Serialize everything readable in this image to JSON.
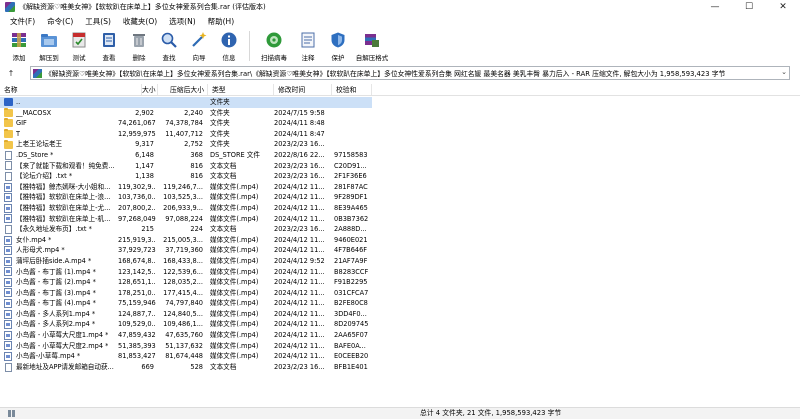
{
  "window": {
    "title": "《解缺资源♡唯美女神》【软软趴在床单上】多位女神爱系列合集.rar (评估版本)",
    "minimize": "—",
    "maximize": "☐",
    "close": "✕"
  },
  "menu": [
    {
      "label": "文件(F)"
    },
    {
      "label": "命令(C)"
    },
    {
      "label": "工具(S)"
    },
    {
      "label": "收藏夹(O)"
    },
    {
      "label": "选项(N)"
    },
    {
      "label": "帮助(H)"
    }
  ],
  "toolbar": [
    {
      "label": "添加",
      "icon": "add-archive-icon",
      "color": "#7b2f8f"
    },
    {
      "label": "解压到",
      "icon": "extract-folder-icon",
      "color": "#3b78c4"
    },
    {
      "label": "测试",
      "icon": "test-icon",
      "color": "#c62e2e"
    },
    {
      "label": "查看",
      "icon": "view-book-icon",
      "color": "#2f5fa8"
    },
    {
      "label": "删除",
      "icon": "delete-trash-icon",
      "color": "#7a7a7a"
    },
    {
      "label": "查找",
      "icon": "find-magnifier-icon",
      "color": "#2a5ba8"
    },
    {
      "label": "向导",
      "icon": "wizard-wand-icon",
      "color": "#2d6bb5"
    },
    {
      "label": "信息",
      "icon": "info-icon",
      "color": "#2f64b0"
    },
    {
      "label": "扫描病毒",
      "icon": "virus-scan-icon",
      "color": "#2f9a3a"
    },
    {
      "label": "注释",
      "icon": "comment-icon",
      "color": "#4c6fa8"
    },
    {
      "label": "保护",
      "icon": "protect-shield-icon",
      "color": "#2e6fc0"
    },
    {
      "label": "自解压格式",
      "icon": "sfx-icon",
      "color": "#4a7a3a"
    }
  ],
  "address": {
    "up_arrow": "↑",
    "text": "《解缺资源♡唯美女神》【软软趴在床单上】多位女神爱系列合集.rar\\《解缺资源♡唯美女神》【软软趴在床单上】多位女神性爱系列合集 网红名媛 最美名器 美乳丰臀 暴力后入 - RAR 压缩文件, 解包大小为 1,958,593,423 字节",
    "dropdown": "⌄"
  },
  "columns": [
    {
      "label": "名称"
    },
    {
      "label": "大小"
    },
    {
      "label": "压缩后大小"
    },
    {
      "label": "类型"
    },
    {
      "label": "修改时间"
    },
    {
      "label": "校验和"
    }
  ],
  "files": [
    {
      "kind": "up",
      "name": "..",
      "size": "",
      "packed": "",
      "type": "文件夹",
      "modified": "",
      "crc": "",
      "selected": true
    },
    {
      "kind": "folder",
      "name": "__MACOSX",
      "size": "2,902",
      "packed": "2,240",
      "type": "文件夹",
      "modified": "2024/7/15 9:58",
      "crc": ""
    },
    {
      "kind": "folder",
      "name": "GIF",
      "size": "74,261,067",
      "packed": "74,378,784",
      "type": "文件夹",
      "modified": "2024/4/11 8:48",
      "crc": ""
    },
    {
      "kind": "folder",
      "name": "T",
      "size": "12,959,975",
      "packed": "11,407,712",
      "type": "文件夹",
      "modified": "2024/4/11 8:47",
      "crc": ""
    },
    {
      "kind": "folder",
      "name": "上老王论坛老王",
      "size": "9,317",
      "packed": "2,752",
      "type": "文件夹",
      "modified": "2023/2/23 16...",
      "crc": ""
    },
    {
      "kind": "doc",
      "name": ".DS_Store *",
      "size": "6,148",
      "packed": "368",
      "type": "DS_STORE 文件",
      "modified": "2022/8/16 22...",
      "crc": "97158583"
    },
    {
      "kind": "doc",
      "name": "【来了就能下载和观看！纯免费...",
      "size": "1,147",
      "packed": "816",
      "type": "文本文档",
      "modified": "2023/2/23 16...",
      "crc": "C20D91..."
    },
    {
      "kind": "doc",
      "name": "【论坛介绍】.txt *",
      "size": "1,138",
      "packed": "816",
      "type": "文本文档",
      "modified": "2023/2/23 16...",
      "crc": "2F1F36E6"
    },
    {
      "kind": "video",
      "name": "【推特福】鲸杰嫣咪-大小姐和...",
      "size": "119,302,9...",
      "packed": "119,246,7...",
      "type": "媒体文件(.mp4)",
      "modified": "2024/4/12 11...",
      "crc": "281F87AC"
    },
    {
      "kind": "video",
      "name": "【推特福】软软趴在床单上-浪...",
      "size": "103,736,0...",
      "packed": "103,525,3...",
      "type": "媒体文件(.mp4)",
      "modified": "2024/4/12 11...",
      "crc": "9F289DF1"
    },
    {
      "kind": "video",
      "name": "【推特福】软软趴在床单上-尤...",
      "size": "207,800,2...",
      "packed": "206,933,9...",
      "type": "媒体文件(.mp4)",
      "modified": "2024/4/12 11...",
      "crc": "8E39A465"
    },
    {
      "kind": "video",
      "name": "【推特福】软软趴在床单上-机...",
      "size": "97,268,049",
      "packed": "97,088,224",
      "type": "媒体文件(.mp4)",
      "modified": "2024/4/12 11...",
      "crc": "0B3B7362"
    },
    {
      "kind": "doc",
      "name": "【永久地址发布页】.txt *",
      "size": "215",
      "packed": "224",
      "type": "文本文档",
      "modified": "2023/2/23 16...",
      "crc": "2A888D..."
    },
    {
      "kind": "video",
      "name": "女仆.mp4 *",
      "size": "215,919,3...",
      "packed": "215,005,3...",
      "type": "媒体文件(.mp4)",
      "modified": "2024/4/12 11...",
      "crc": "9460E021"
    },
    {
      "kind": "video",
      "name": "人形母犬.mp4 *",
      "size": "37,929,723",
      "packed": "37,719,360",
      "type": "媒体文件(.mp4)",
      "modified": "2024/4/12 11...",
      "crc": "4F7B646F"
    },
    {
      "kind": "video",
      "name": "蒲坪后卧插side.A.mp4 *",
      "size": "168,674,8...",
      "packed": "168,433,8...",
      "type": "媒体文件(.mp4)",
      "modified": "2024/4/12 9:52",
      "crc": "21AF7A9F"
    },
    {
      "kind": "video",
      "name": "小鸟酱 - 布丁酱 (1).mp4 *",
      "size": "123,142,5...",
      "packed": "122,539,6...",
      "type": "媒体文件(.mp4)",
      "modified": "2024/4/12 11...",
      "crc": "B8283CCF"
    },
    {
      "kind": "video",
      "name": "小鸟酱 - 布丁酱 (2).mp4 *",
      "size": "128,651,1...",
      "packed": "128,035,2...",
      "type": "媒体文件(.mp4)",
      "modified": "2024/4/12 11...",
      "crc": "F91B2295"
    },
    {
      "kind": "video",
      "name": "小鸟酱 - 布丁酱 (3).mp4 *",
      "size": "178,251,0...",
      "packed": "177,415,4...",
      "type": "媒体文件(.mp4)",
      "modified": "2024/4/12 11...",
      "crc": "031CFCA7"
    },
    {
      "kind": "video",
      "name": "小鸟酱 - 布丁酱 (4).mp4 *",
      "size": "75,159,946",
      "packed": "74,797,840",
      "type": "媒体文件(.mp4)",
      "modified": "2024/4/12 11...",
      "crc": "B2FE80C8"
    },
    {
      "kind": "video",
      "name": "小鸟酱 - 多人系列1.mp4 *",
      "size": "124,887,7...",
      "packed": "124,840,5...",
      "type": "媒体文件(.mp4)",
      "modified": "2024/4/12 11...",
      "crc": "3DD4F0..."
    },
    {
      "kind": "video",
      "name": "小鸟酱 - 多人系列2.mp4 *",
      "size": "109,529,0...",
      "packed": "109,486,1...",
      "type": "媒体文件(.mp4)",
      "modified": "2024/4/12 11...",
      "crc": "8D209745"
    },
    {
      "kind": "video",
      "name": "小鸟酱 - 小草莓大尺度1.mp4 *",
      "size": "47,859,432",
      "packed": "47,635,760",
      "type": "媒体文件(.mp4)",
      "modified": "2024/4/12 11...",
      "crc": "2AA65F07"
    },
    {
      "kind": "video",
      "name": "小鸟酱 - 小草莓大尺度2.mp4 *",
      "size": "51,385,393",
      "packed": "51,137,632",
      "type": "媒体文件(.mp4)",
      "modified": "2024/4/12 11...",
      "crc": "BAFE0A..."
    },
    {
      "kind": "video",
      "name": "小鸟酱-小草莓.mp4 *",
      "size": "81,853,427",
      "packed": "81,674,448",
      "type": "媒体文件(.mp4)",
      "modified": "2024/4/12 11...",
      "crc": "E0CEEB20"
    },
    {
      "kind": "doc",
      "name": "最新地址及APP请发邮箱自动获...",
      "size": "669",
      "packed": "528",
      "type": "文本文档",
      "modified": "2023/2/23 16...",
      "crc": "BFB1E401"
    }
  ],
  "status": {
    "text": "总计 4 文件夹, 21 文件, 1,958,593,423 字节"
  }
}
